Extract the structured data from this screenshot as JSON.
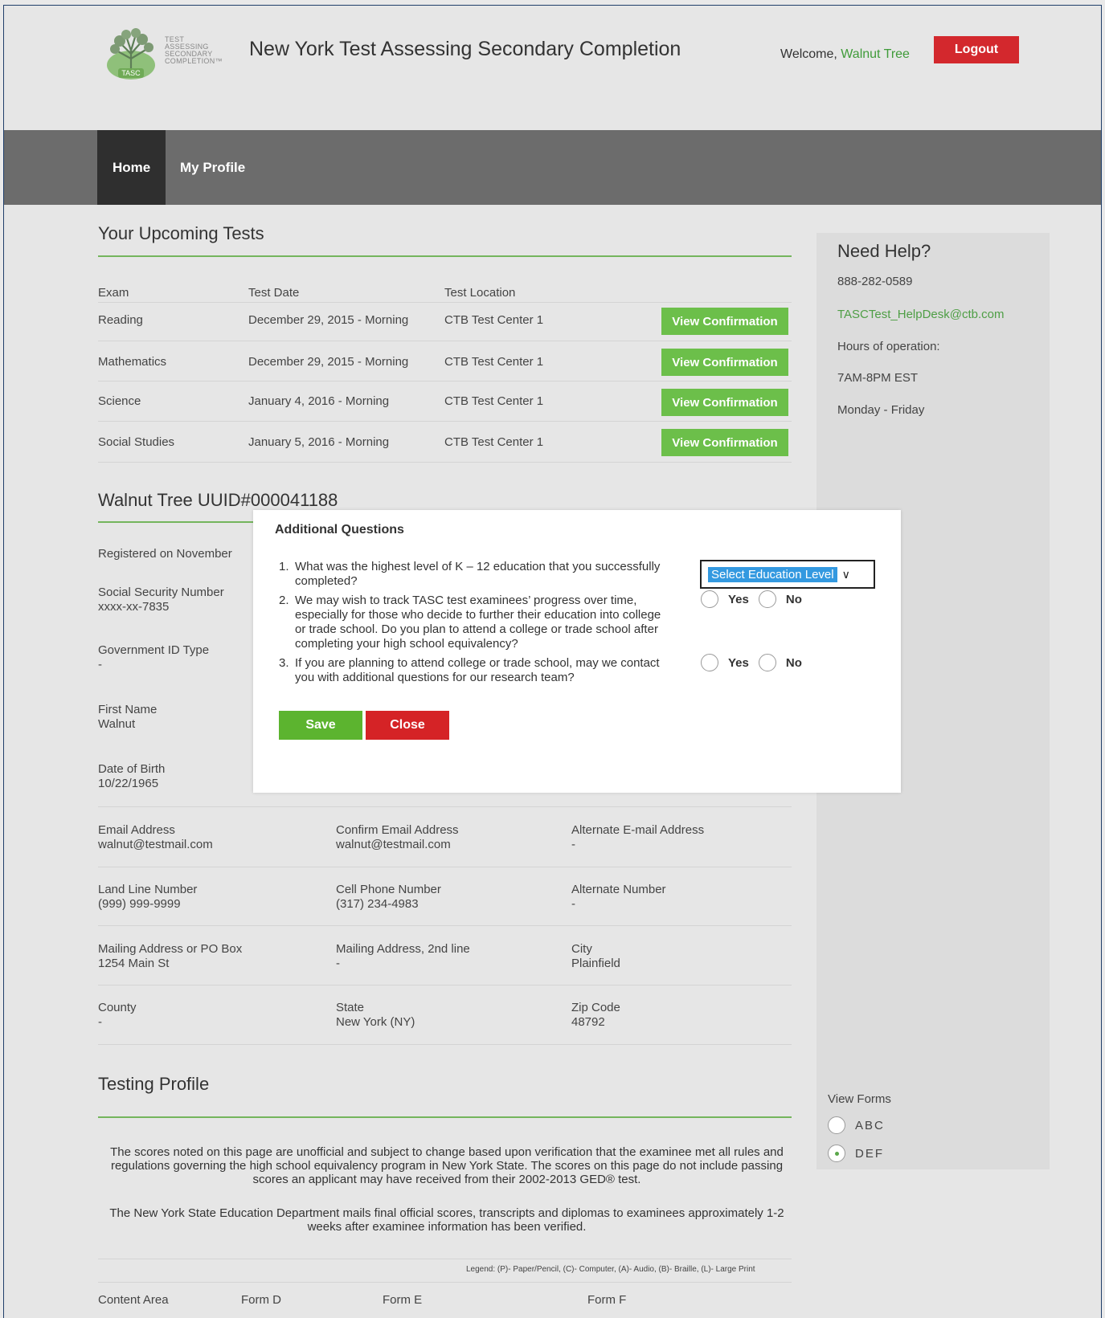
{
  "header": {
    "logo_lines": [
      "TEST",
      "ASSESSING",
      "SECONDARY",
      "COMPLETION™"
    ],
    "logo_badge": "TASC",
    "title": "New York Test Assessing Secondary Completion",
    "welcome_prefix": "Welcome, ",
    "user_name": "Walnut Tree",
    "logout_label": "Logout"
  },
  "nav": {
    "items": [
      "Home",
      "My Profile"
    ],
    "active": "Home"
  },
  "upcoming": {
    "title": "Your Upcoming Tests",
    "columns": [
      "Exam",
      "Test Date",
      "Test Location"
    ],
    "button_label": "View Confirmation",
    "rows": [
      {
        "exam": "Reading",
        "date": "December 29, 2015 - Morning",
        "location": "CTB Test Center 1"
      },
      {
        "exam": "Mathematics",
        "date": "December 29, 2015 - Morning",
        "location": "CTB Test Center 1"
      },
      {
        "exam": "Science",
        "date": "January 4, 2016 - Morning",
        "location": "CTB Test Center 1"
      },
      {
        "exam": "Social Studies",
        "date": "January 5, 2016 - Morning",
        "location": "CTB Test Center 1"
      }
    ]
  },
  "profile": {
    "title": "Walnut Tree UUID#000041188",
    "registered": "Registered on November",
    "ssn_label": "Social Security Number",
    "ssn_value": "xxxx-xx-7835",
    "govid_label": "Government ID Type",
    "govid_value": "-",
    "first_label": "First Name",
    "first_value": "Walnut",
    "dob_label": "Date of Birth",
    "dob_value": "10/22/1965",
    "email_label": "Email Address",
    "email_value": "walnut@testmail.com",
    "cemail_label": "Confirm Email Address",
    "cemail_value": "walnut@testmail.com",
    "aemail_label": "Alternate E-mail Address",
    "aemail_value": "-",
    "land_label": "Land Line Number",
    "land_value": "(999) 999-9999",
    "cell_label": "Cell Phone Number",
    "cell_value": "(317) 234-4983",
    "alt_label": "Alternate Number",
    "alt_value": "-",
    "addr_label": "Mailing Address or PO Box",
    "addr_value": "1254 Main St",
    "addr2_label": "Mailing Address, 2nd line",
    "addr2_value": "-",
    "city_label": "City",
    "city_value": "Plainfield",
    "county_label": "County",
    "county_value": "-",
    "state_label": "State",
    "state_value": "New York (NY)",
    "zip_label": "Zip Code",
    "zip_value": "48792"
  },
  "testing": {
    "title": "Testing Profile",
    "para1": "The scores noted on this page are unofficial and subject to change based upon verification that the examinee met all rules and regulations governing the high school equivalency program in New York State. The scores on this page do not include passing scores an applicant may have received from their 2002-2013 GED® test.",
    "para2": "The New York State Education Department mails final official scores, transcripts and diplomas to examinees approximately 1-2 weeks after examinee information has been verified.",
    "legend": "Legend: (P)- Paper/Pencil, (C)- Computer, (A)- Audio, (B)- Braille, (L)- Large Print",
    "columns": [
      "Content Area",
      "Form D",
      "Form E",
      "Form F"
    ]
  },
  "sidebar": {
    "title": "Need Help?",
    "phone": "888-282-0589",
    "email": "TASCTest_HelpDesk@ctb.com",
    "hours_label": "Hours of operation:",
    "hours": "7AM-8PM EST",
    "days": "Monday - Friday",
    "view_forms_label": "View Forms",
    "forms": [
      {
        "label": "ABC",
        "checked": false
      },
      {
        "label": "DEF",
        "checked": true
      }
    ]
  },
  "modal": {
    "title": "Additional Questions",
    "questions": [
      {
        "num": "1.",
        "text": "What was the highest level of K – 12 education that you successfully completed?"
      },
      {
        "num": "2.",
        "text": "We may wish to track TASC test examinees’ progress over time, especially for those who decide to further their education into college or trade school. Do you plan to attend a college or trade school after completing your high school equivalency?"
      },
      {
        "num": "3.",
        "text": "If you are planning to attend college or trade school, may we contact you with additional questions for our research team?"
      }
    ],
    "select_value": "Select Education Level",
    "yes_label": "Yes",
    "no_label": "No",
    "save_label": "Save",
    "close_label": "Close"
  },
  "colors": {
    "accent_green": "#6cbf4a",
    "logout_red": "#d3282d",
    "nav_bg": "#6c6c6c",
    "nav_active": "#2f2f2f",
    "link_green": "#4e9e45"
  }
}
